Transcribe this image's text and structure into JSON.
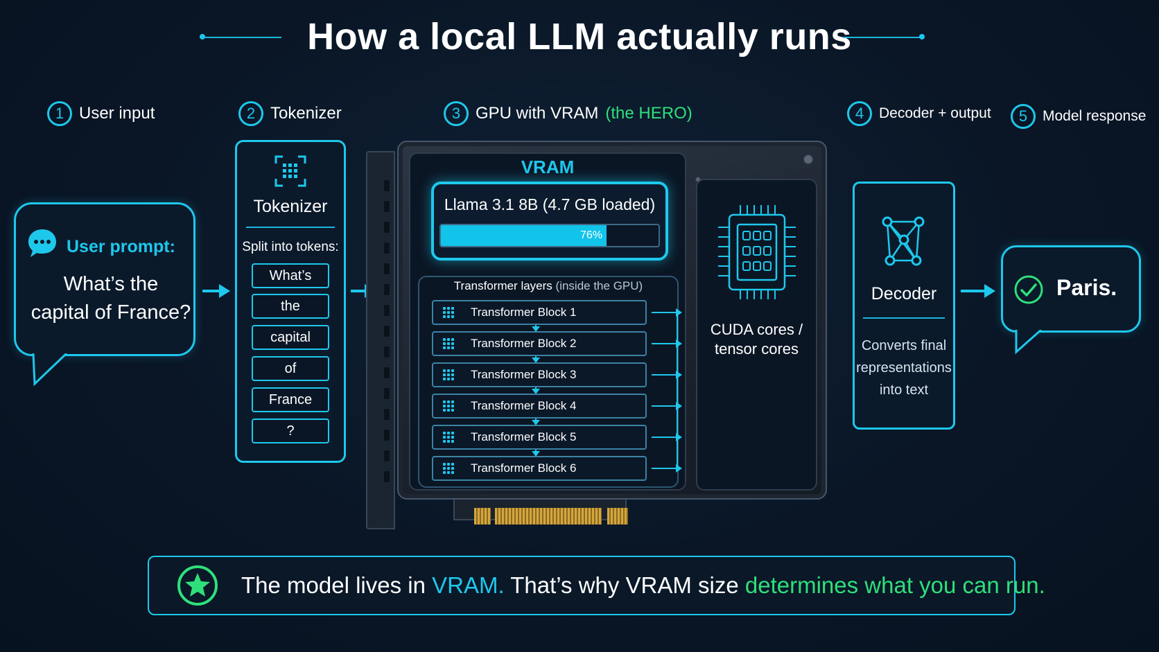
{
  "title": "How a local LLM actually runs",
  "steps": [
    {
      "num": "1",
      "label": "User input"
    },
    {
      "num": "2",
      "label": "Tokenizer"
    },
    {
      "num": "3",
      "label": "GPU with VRAM",
      "highlight": "(the HERO)"
    },
    {
      "num": "4",
      "label": "Decoder + output"
    },
    {
      "num": "5",
      "label": "Model response"
    }
  ],
  "user_prompt": {
    "label": "User prompt:",
    "line1": "What’s the",
    "line2": "capital of France?"
  },
  "tokenizer": {
    "title": "Tokenizer",
    "split_label": "Split into tokens:",
    "tokens": [
      "What’s",
      "the",
      "capital",
      "of",
      "France",
      "?"
    ]
  },
  "gpu": {
    "vram_title": "VRAM",
    "model_loaded": "Llama 3.1 8B (4.7 GB loaded)",
    "usage_percent": 76,
    "usage_label": "76%",
    "layers_title": "Transformer layers",
    "layers_note": "(inside the GPU)",
    "blocks": [
      "Transformer Block 1",
      "Transformer Block 2",
      "Transformer Block 3",
      "Transformer Block 4",
      "Transformer Block 5",
      "Transformer Block 6"
    ],
    "cores_line1": "CUDA cores /",
    "cores_line2": "tensor cores"
  },
  "decoder": {
    "title": "Decoder",
    "line1": "Converts final",
    "line2": "representations",
    "line3": "into text"
  },
  "response": {
    "text": "Paris."
  },
  "banner": {
    "part1": "The model lives in ",
    "part2": "VRAM.",
    "part3": " That’s why VRAM size ",
    "part4": "determines what you can run."
  },
  "colors": {
    "accent": "#1ec8ec",
    "highlight": "#2fe07a",
    "background": "#0a1626"
  },
  "icons": [
    "chat-icon",
    "scan-icon",
    "chip-icon",
    "network-icon",
    "check-icon",
    "star-icon"
  ]
}
